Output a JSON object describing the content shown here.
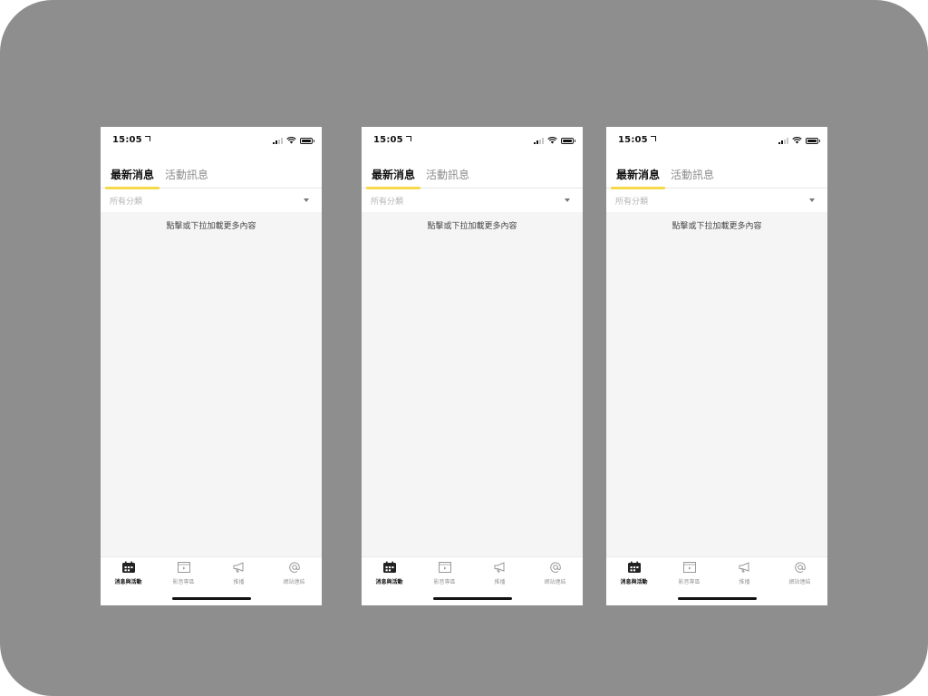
{
  "screens": [
    {
      "status": {
        "time": "15:05"
      },
      "tabs": [
        {
          "label": "最新消息",
          "active": true
        },
        {
          "label": "活動訊息",
          "active": false
        }
      ],
      "filter": {
        "label": "所有分類"
      },
      "content": {
        "load_more": "點擊或下拉加載更多內容"
      },
      "nav": [
        {
          "label": "消息與活動",
          "icon": "calendar-icon",
          "active": true
        },
        {
          "label": "影音專區",
          "icon": "video-icon",
          "active": false
        },
        {
          "label": "推播",
          "icon": "megaphone-icon",
          "active": false
        },
        {
          "label": "網站連結",
          "icon": "at-icon",
          "active": false
        }
      ]
    },
    {
      "status": {
        "time": "15:05"
      },
      "tabs": [
        {
          "label": "最新消息",
          "active": true
        },
        {
          "label": "活動訊息",
          "active": false
        }
      ],
      "filter": {
        "label": "所有分類"
      },
      "content": {
        "load_more": "點擊或下拉加載更多內容"
      },
      "nav": [
        {
          "label": "消息與活動",
          "icon": "calendar-icon",
          "active": true
        },
        {
          "label": "影音專區",
          "icon": "video-icon",
          "active": false
        },
        {
          "label": "推播",
          "icon": "megaphone-icon",
          "active": false
        },
        {
          "label": "網站連結",
          "icon": "at-icon",
          "active": false
        }
      ]
    },
    {
      "status": {
        "time": "15:05"
      },
      "tabs": [
        {
          "label": "最新消息",
          "active": true
        },
        {
          "label": "活動訊息",
          "active": false
        }
      ],
      "filter": {
        "label": "所有分類"
      },
      "content": {
        "load_more": "點擊或下拉加載更多內容"
      },
      "nav": [
        {
          "label": "消息與活動",
          "icon": "calendar-icon",
          "active": true
        },
        {
          "label": "影音專區",
          "icon": "video-icon",
          "active": false
        },
        {
          "label": "推播",
          "icon": "megaphone-icon",
          "active": false
        },
        {
          "label": "網站連結",
          "icon": "at-icon",
          "active": false
        }
      ]
    }
  ],
  "colors": {
    "backdrop": "#8e8e8e",
    "accent": "#f5d94a",
    "content_bg": "#f5f5f5",
    "active_text": "#111111",
    "inactive_text": "#8c8c8c"
  }
}
